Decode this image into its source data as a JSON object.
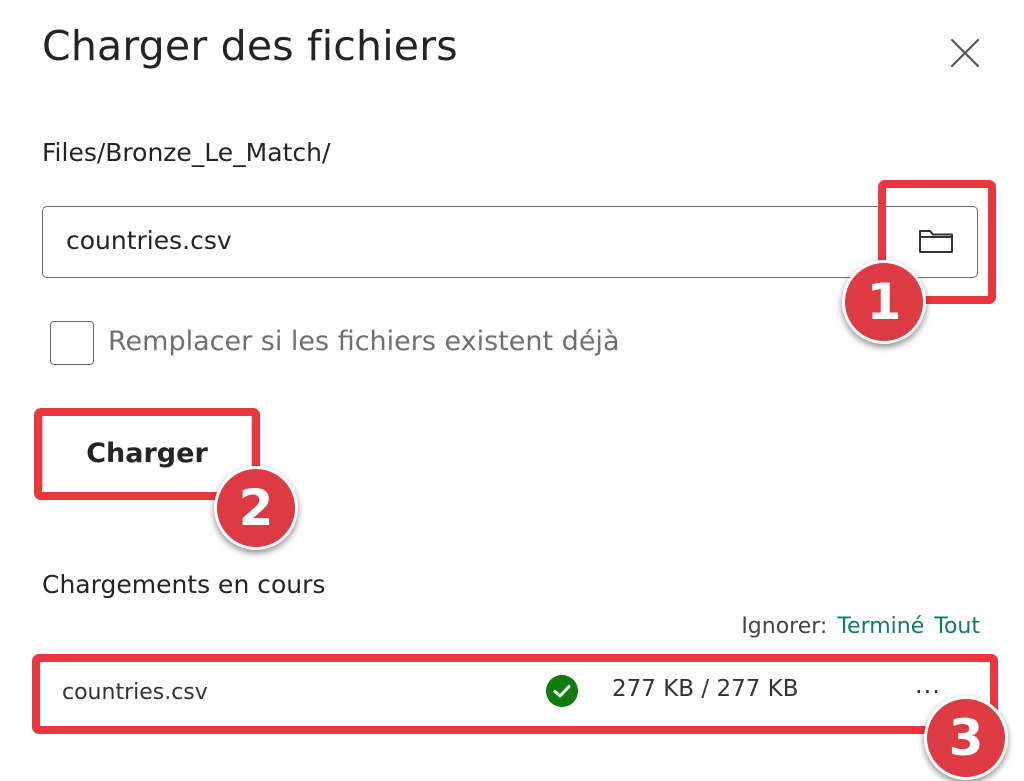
{
  "dialog": {
    "title": "Charger des fichiers",
    "path": "Files/Bronze_Le_Match/",
    "file_input": {
      "value": "countries.csv"
    },
    "overwrite_checkbox": {
      "label": "Remplacer si les fichiers existent déjà",
      "checked": false
    },
    "upload_button": {
      "label": "Charger"
    },
    "uploads_section": {
      "title": "Chargements en cours",
      "ignore": {
        "label": "Ignorer:",
        "done": "Terminé",
        "all": "Tout"
      },
      "items": [
        {
          "name": "countries.csv",
          "status": "complete",
          "size": "277 KB / 277 KB",
          "more": "···"
        }
      ]
    }
  },
  "annotations": {
    "badges": [
      "1",
      "2",
      "3"
    ],
    "color": "#e8383d"
  },
  "colors": {
    "link": "#0f7b6c",
    "success": "#107c10",
    "highlight": "#e8383d"
  }
}
